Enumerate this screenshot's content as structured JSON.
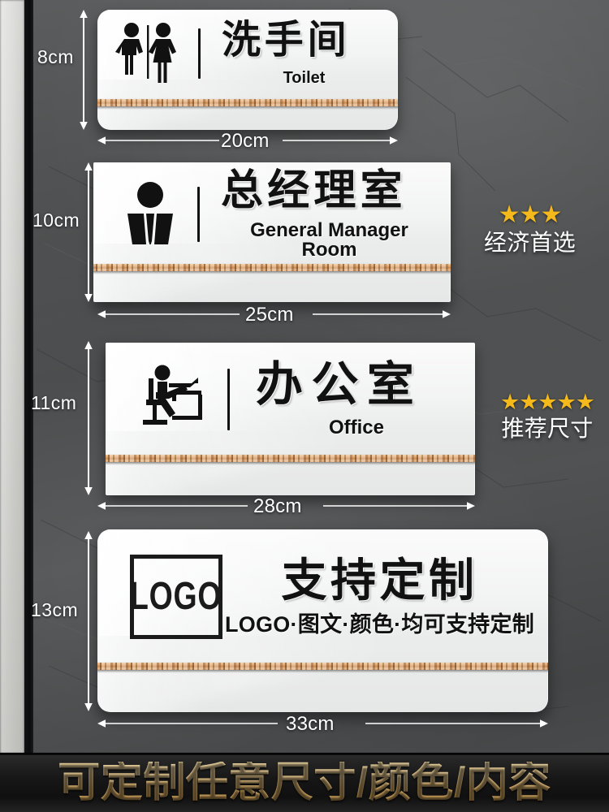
{
  "background": {
    "wall_color": "#4a4c4d",
    "accent_bronze": "#d79f6e",
    "star_color": "#f5b91c"
  },
  "signs": [
    {
      "id": "toilet",
      "icon": "male-female-restroom-icon",
      "title_cn": "洗手间",
      "title_en": "Toilet",
      "height_label": "8cm",
      "width_label": "20cm"
    },
    {
      "id": "general-manager",
      "icon": "businessman-suit-icon",
      "title_cn": "总经理室",
      "title_en": "General Manager Room",
      "height_label": "10cm",
      "width_label": "25cm"
    },
    {
      "id": "office",
      "icon": "person-at-desk-icon",
      "title_cn": "办公室",
      "title_en": "Office",
      "height_label": "11cm",
      "width_label": "28cm"
    },
    {
      "id": "custom-logo",
      "icon": "logo-placeholder-icon",
      "logo_text": "LOGO",
      "title_cn": "支持定制",
      "title_en": "LOGO·图文·颜色·均可支持定制",
      "height_label": "13cm",
      "width_label": "33cm"
    }
  ],
  "ratings": [
    {
      "id": "economy",
      "stars": "★★★",
      "count": 3,
      "label": "经济首选"
    },
    {
      "id": "recommended",
      "stars": "★★★★★",
      "count": 5,
      "label": "推荐尺寸"
    }
  ],
  "banner": {
    "text": "可定制任意尺寸/颜色/内容"
  }
}
